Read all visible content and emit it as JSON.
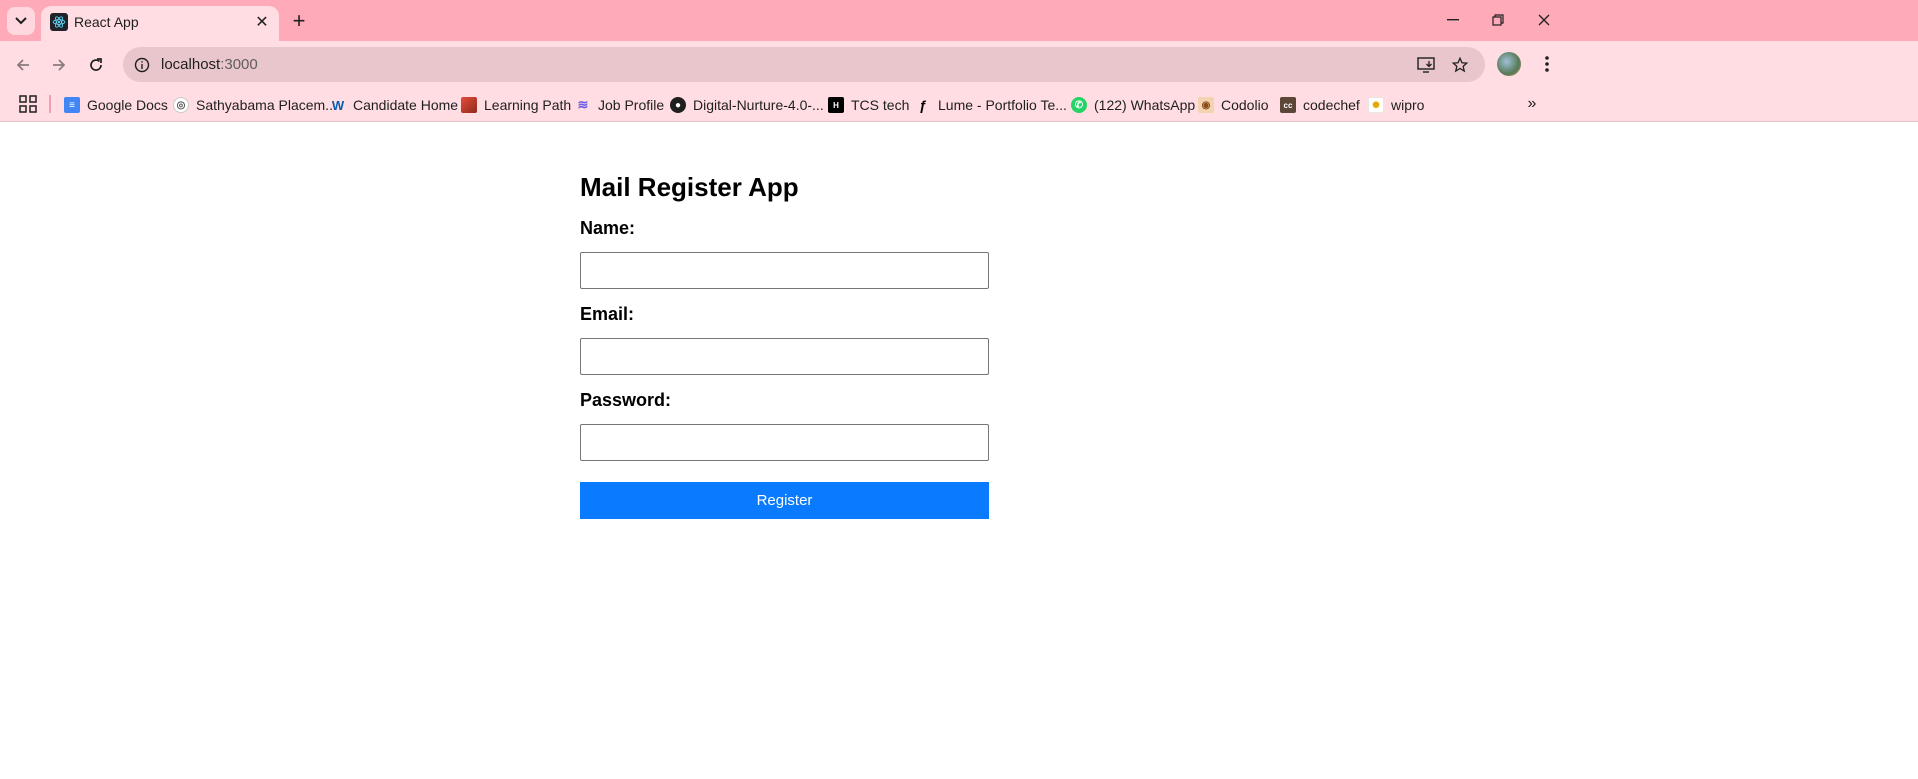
{
  "browser": {
    "tab": {
      "title": "React App"
    },
    "address_bar": {
      "host": "localhost",
      "port": ":3000"
    },
    "bookmarks": [
      {
        "label": "Google Docs",
        "icon": "google-docs-icon",
        "color": "#4285f4"
      },
      {
        "label": "Sathyabama Placem...",
        "icon": "sathyabama-icon",
        "color": "#c9c9c9"
      },
      {
        "label": "Candidate Home",
        "icon": "workday-icon",
        "color": "#f5a623"
      },
      {
        "label": "Learning Path",
        "icon": "learning-path-icon",
        "color": "#c0392b"
      },
      {
        "label": "Job Profile",
        "icon": "job-profile-icon",
        "color": "#6c5ce7"
      },
      {
        "label": "Digital-Nurture-4.0-...",
        "icon": "github-icon",
        "color": "#1f1f1f"
      },
      {
        "label": "TCS tech",
        "icon": "tcs-icon",
        "color": "#000000"
      },
      {
        "label": "Lume - Portfolio Te...",
        "icon": "framer-icon",
        "color": "#000000"
      },
      {
        "label": "(122) WhatsApp",
        "icon": "whatsapp-icon",
        "color": "#25d366"
      },
      {
        "label": "Codolio",
        "icon": "codolio-icon",
        "color": "#b5651d"
      },
      {
        "label": "codechef",
        "icon": "codechef-icon",
        "color": "#5b4638"
      },
      {
        "label": "wipro",
        "icon": "wipro-icon",
        "color": "#e6e6e6"
      }
    ]
  },
  "form": {
    "title": "Mail Register App",
    "name_label": "Name:",
    "email_label": "Email:",
    "password_label": "Password:",
    "name_value": "",
    "email_value": "",
    "password_value": "",
    "submit_label": "Register",
    "accent_color": "#0a7bff"
  }
}
